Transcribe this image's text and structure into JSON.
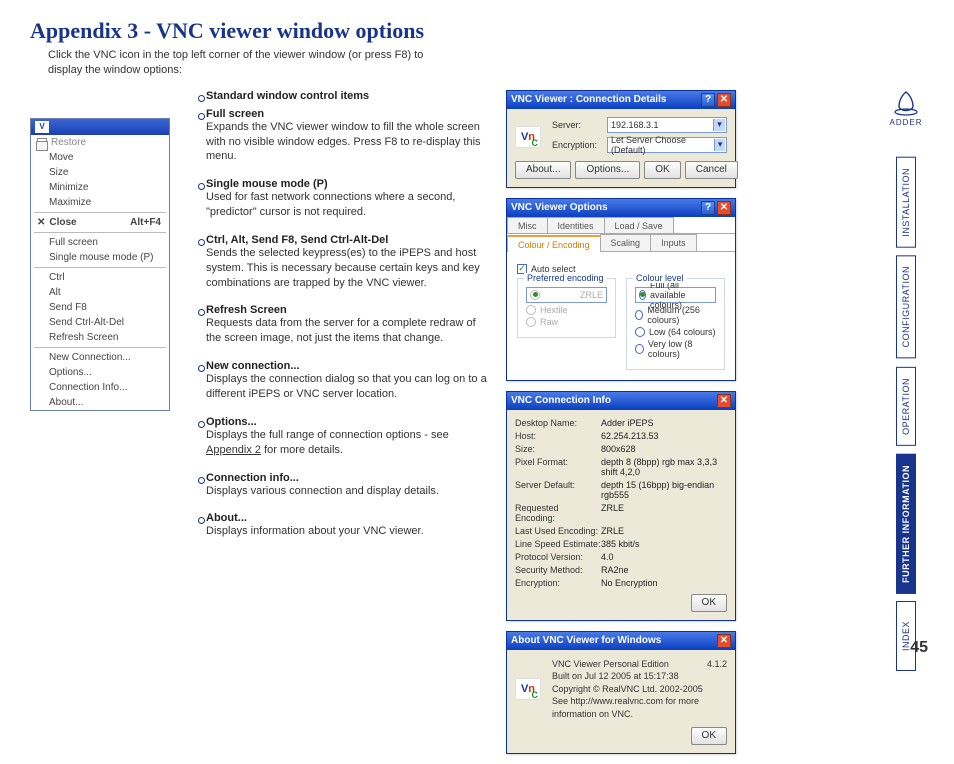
{
  "title": "Appendix 3 - VNC viewer window options",
  "intro": "Click the VNC icon in the top left corner of the viewer window (or press F8) to display the window options:",
  "page_number": "45",
  "adder_label": "ADDER",
  "ctx": {
    "restore": "Restore",
    "move": "Move",
    "size": "Size",
    "minimize": "Minimize",
    "maximize": "Maximize",
    "close": "Close",
    "close_key": "Alt+F4",
    "fullscreen": "Full screen",
    "single_mouse": "Single mouse mode (P)",
    "ctrl": "Ctrl",
    "alt": "Alt",
    "sendf8": "Send F8",
    "sendcad": "Send Ctrl-Alt-Del",
    "refresh": "Refresh Screen",
    "newconn": "New Connection...",
    "options": "Options...",
    "conninfo": "Connection Info...",
    "about": "About..."
  },
  "desc": {
    "std": {
      "t": "Standard window control items"
    },
    "full": {
      "t": "Full screen",
      "b": "Expands the VNC viewer window to fill the whole screen with no visible window edges. Press F8 to re-display this menu."
    },
    "single": {
      "t": "Single mouse mode (P)",
      "b": "Used for fast network connections where a second, \"predictor\" cursor is not required."
    },
    "keys": {
      "t": "Ctrl, Alt, Send F8, Send Ctrl-Alt-Del",
      "b": "Sends the selected keypress(es) to the iPEPS and host system. This is necessary because certain keys and key combinations are trapped by the VNC viewer."
    },
    "refresh": {
      "t": "Refresh Screen",
      "b": "Requests data from the server for a complete redraw of the screen image, not just the items that change."
    },
    "new": {
      "t": "New connection...",
      "b": "Displays the connection dialog so that you can log on to a different iPEPS or VNC server location."
    },
    "opts": {
      "t": "Options...",
      "b1": "Displays the full range of connection options - see ",
      "link": "Appendix 2",
      "b2": " for more details."
    },
    "cinfo": {
      "t": "Connection info...",
      "b": "Displays various connection and display details."
    },
    "about": {
      "t": "About...",
      "b": "Displays information about your VNC viewer."
    }
  },
  "d1": {
    "title": "VNC Viewer : Connection Details",
    "server_lbl": "Server:",
    "server_val": "192.168.3.1",
    "enc_lbl": "Encryption:",
    "enc_val": "Let Server Choose (Default)",
    "about": "About...",
    "options": "Options...",
    "ok": "OK",
    "cancel": "Cancel"
  },
  "d2": {
    "title": "VNC Viewer Options",
    "tab_misc": "Misc",
    "tab_ident": "Identities",
    "tab_load": "Load / Save",
    "tab_colour": "Colour / Encoding",
    "tab_scaling": "Scaling",
    "tab_inputs": "Inputs",
    "auto": "Auto select",
    "pref_lbl": "Preferred encoding",
    "zrle": "ZRLE",
    "hextile": "Hextile",
    "raw": "Raw",
    "col_lbl": "Colour level",
    "c_full": "Full (all available colours)",
    "c_med": "Medium (256 colours)",
    "c_low": "Low (64 colours)",
    "c_vlow": "Very low (8 colours)"
  },
  "d3": {
    "title": "VNC Connection Info",
    "k": [
      "Desktop Name:",
      "Host:",
      "Size:",
      "Pixel Format:",
      "Server Default:",
      "Requested Encoding:",
      "Last Used Encoding:",
      "Line Speed Estimate:",
      "Protocol Version:",
      "Security Method:",
      "Encryption:"
    ],
    "v": [
      "Adder iPEPS",
      "62.254.213.53",
      "800x628",
      "depth 8 (8bpp) rgb max 3,3,3 shift 4,2,0",
      "depth 15 (16bpp) big-endian rgb555",
      "ZRLE",
      "ZRLE",
      "385 kbit/s",
      "4.0",
      "RA2ne",
      "No Encryption"
    ],
    "ok": "OK"
  },
  "d4": {
    "title": "About VNC Viewer for Windows",
    "line1": "VNC Viewer Personal Edition",
    "ver": "4.1.2",
    "line2": "Built on Jul 12 2005 at 15:17:38",
    "line3": "Copyright © RealVNC Ltd. 2002-2005",
    "line4": "See http://www.realvnc.com for more information on VNC.",
    "ok": "OK"
  },
  "nav": {
    "install": "INSTALLATION",
    "config": "CONFIGURATION",
    "oper": "OPERATION",
    "further": "FURTHER INFORMATION",
    "index": "INDEX"
  }
}
